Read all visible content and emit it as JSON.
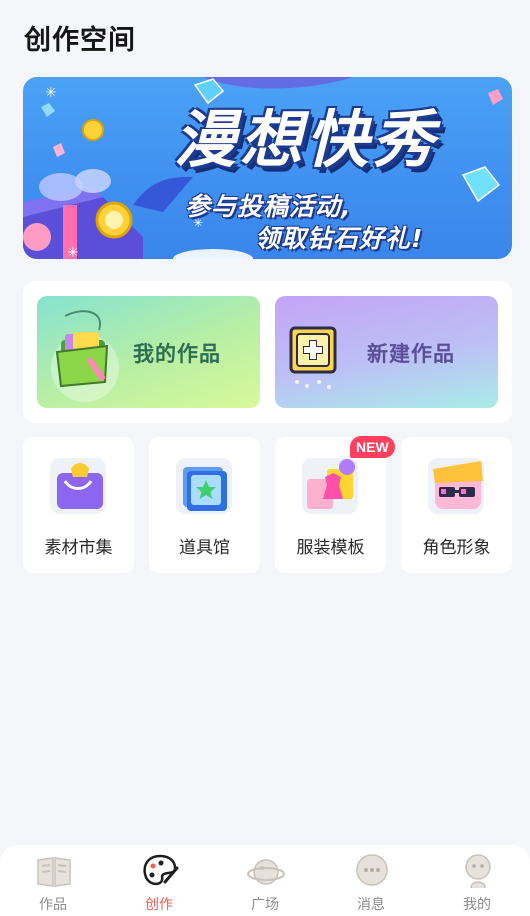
{
  "header": {
    "title": "创作空间"
  },
  "banner": {
    "title": "漫想快秀",
    "subtitle_line1": "参与投稿活动,",
    "subtitle_line2": "领取钻石好礼!"
  },
  "works": {
    "my_works_label": "我的作品",
    "new_work_label": "新建作品"
  },
  "tools": [
    {
      "label": "素材市集",
      "icon": "shopping-bag-icon"
    },
    {
      "label": "道具馆",
      "icon": "star-frame-icon"
    },
    {
      "label": "服装模板",
      "icon": "clothing-icon",
      "badge": "NEW"
    },
    {
      "label": "角色形象",
      "icon": "character-face-icon"
    }
  ],
  "tabbar": {
    "items": [
      {
        "label": "作品",
        "icon": "book-icon",
        "active": false
      },
      {
        "label": "创作",
        "icon": "palette-icon",
        "active": true
      },
      {
        "label": "广场",
        "icon": "planet-icon",
        "active": false
      },
      {
        "label": "消息",
        "icon": "chat-bubble-icon",
        "active": false
      },
      {
        "label": "我的",
        "icon": "person-icon",
        "active": false
      }
    ]
  },
  "colors": {
    "accent": "#ff5a4f",
    "badge": "#ff3f5e",
    "banner_blue": "#4ba2f5"
  }
}
